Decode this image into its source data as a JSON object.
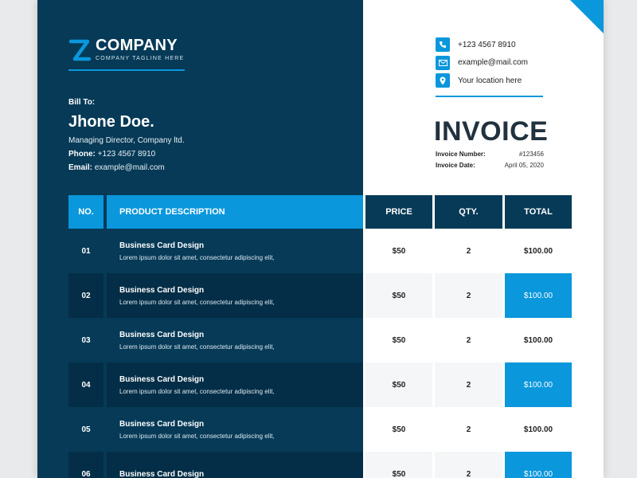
{
  "company": {
    "name": "COMPANY",
    "tagline": "COMPANY TAGLINE HERE"
  },
  "contacts": [
    {
      "icon": "phone-icon",
      "text": "+123 4567 8910"
    },
    {
      "icon": "mail-icon",
      "text": "example@mail.com"
    },
    {
      "icon": "location-pin-icon",
      "text": "Your location here"
    }
  ],
  "bill_to": {
    "label": "Bill To:",
    "name": "Jhone Doe.",
    "title": "Managing Director, Company ltd.",
    "phone_label": "Phone:",
    "phone": "+123 4567 8910",
    "email_label": "Email:",
    "email": "example@mail.com"
  },
  "invoice": {
    "title": "INVOICE",
    "number_label": "Invoice Number:",
    "number": "#123456",
    "date_label": "Invoice Date:",
    "date": "April 05, 2020"
  },
  "table": {
    "headers": {
      "no": "NO.",
      "description": "PRODUCT DESCRIPTION",
      "price": "PRICE",
      "qty": "QTY.",
      "total": "TOTAL"
    },
    "rows": [
      {
        "no": "01",
        "title": "Business Card Design",
        "desc": "Lorem ipsum dolor sit amet, consectetur adipiscing elit,",
        "price": "$50",
        "qty": "2",
        "total": "$100.00"
      },
      {
        "no": "02",
        "title": "Business Card Design",
        "desc": "Lorem ipsum dolor sit amet, consectetur adipiscing elit,",
        "price": "$50",
        "qty": "2",
        "total": "$100.00"
      },
      {
        "no": "03",
        "title": "Business Card Design",
        "desc": "Lorem ipsum dolor sit amet, consectetur adipiscing elit,",
        "price": "$50",
        "qty": "2",
        "total": "$100.00"
      },
      {
        "no": "04",
        "title": "Business Card Design",
        "desc": "Lorem ipsum dolor sit amet, consectetur adipiscing elit,",
        "price": "$50",
        "qty": "2",
        "total": "$100.00"
      },
      {
        "no": "05",
        "title": "Business Card Design",
        "desc": "Lorem ipsum dolor sit amet, consectetur adipiscing elit,",
        "price": "$50",
        "qty": "2",
        "total": "$100.00"
      },
      {
        "no": "06",
        "title": "Business Card Design",
        "desc": "",
        "price": "$50",
        "qty": "2",
        "total": "$100.00"
      }
    ]
  },
  "colors": {
    "navy": "#063a57",
    "navy_alt": "#042e47",
    "accent": "#0a97dc",
    "light_cell": "#f4f6f8",
    "title_text": "#21323f"
  }
}
